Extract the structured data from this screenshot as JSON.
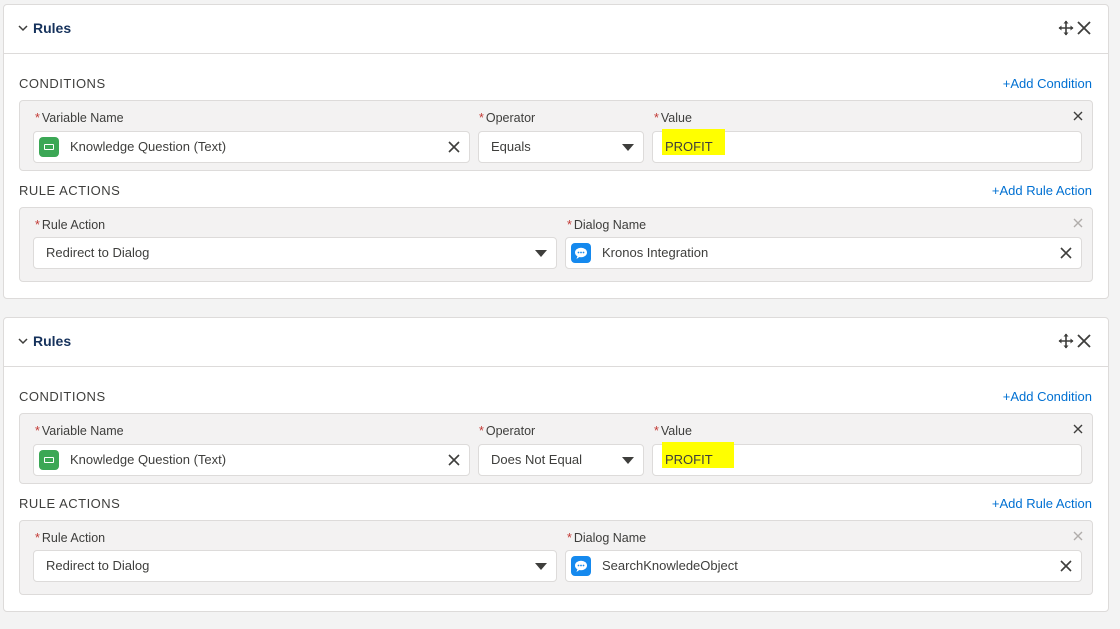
{
  "rules": [
    {
      "title": "Rules",
      "conditions_label": "CONDITIONS",
      "add_condition": "+Add Condition",
      "variable_label": "Variable Name",
      "variable_value": "Knowledge Question (Text)",
      "operator_label": "Operator",
      "operator_value": "Equals",
      "value_label": "Value",
      "value_value": "PROFIT",
      "actions_label": "RULE ACTIONS",
      "add_action": "+Add Rule Action",
      "rule_action_label": "Rule Action",
      "rule_action_value": "Redirect to Dialog",
      "dialog_label": "Dialog Name",
      "dialog_value": "Kronos Integration"
    },
    {
      "title": "Rules",
      "conditions_label": "CONDITIONS",
      "add_condition": "+Add Condition",
      "variable_label": "Variable Name",
      "variable_value": "Knowledge Question (Text)",
      "operator_label": "Operator",
      "operator_value": "Does Not Equal",
      "value_label": "Value",
      "value_value": "PROFIT",
      "actions_label": "RULE ACTIONS",
      "add_action": "+Add Rule Action",
      "rule_action_label": "Rule Action",
      "rule_action_value": "Redirect to Dialog",
      "dialog_label": "Dialog Name",
      "dialog_value": "SearchKnowledeObject"
    }
  ],
  "colors": {
    "link": "#0070d2",
    "required": "#c23934",
    "highlight": "#ffff00",
    "variable_icon": "#3ba755",
    "dialog_icon": "#1589ee"
  }
}
